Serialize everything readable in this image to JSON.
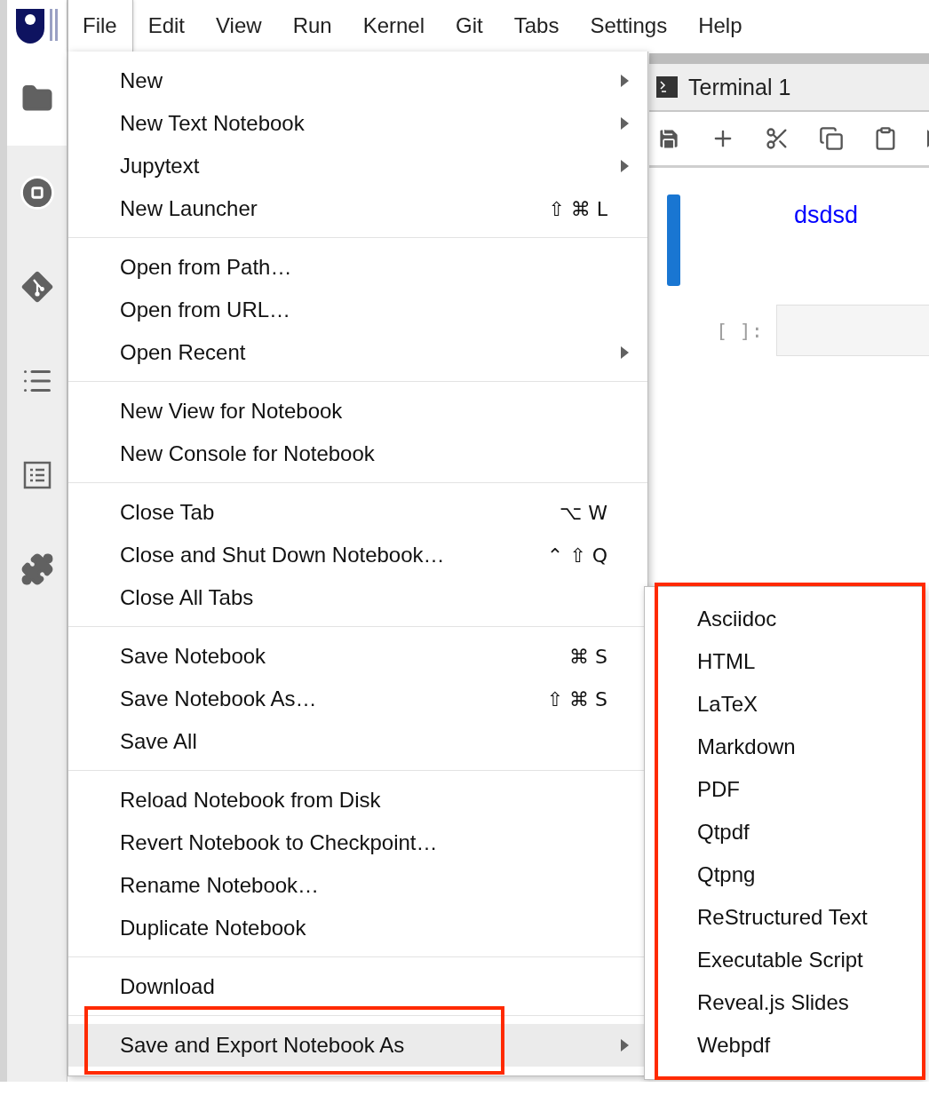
{
  "menubar": [
    {
      "label": "File",
      "selected": true
    },
    {
      "label": "Edit",
      "selected": false
    },
    {
      "label": "View",
      "selected": false
    },
    {
      "label": "Run",
      "selected": false
    },
    {
      "label": "Kernel",
      "selected": false
    },
    {
      "label": "Git",
      "selected": false
    },
    {
      "label": "Tabs",
      "selected": false
    },
    {
      "label": "Settings",
      "selected": false
    },
    {
      "label": "Help",
      "selected": false
    }
  ],
  "sidebar": {
    "items": [
      {
        "kind": "folder",
        "selected": true
      },
      {
        "kind": "running",
        "selected": false
      },
      {
        "kind": "git",
        "selected": false
      },
      {
        "kind": "toc",
        "selected": false
      },
      {
        "kind": "commands",
        "selected": false
      },
      {
        "kind": "extensions",
        "selected": false
      }
    ]
  },
  "file_menu": {
    "groups": [
      [
        {
          "label": "New",
          "submenu": true,
          "selected": false
        },
        {
          "label": "New Text Notebook",
          "submenu": true,
          "selected": false
        },
        {
          "label": "Jupytext",
          "submenu": true,
          "selected": false
        },
        {
          "label": "New Launcher",
          "shortcut": "⇧ ⌘ L",
          "submenu": false,
          "selected": false
        }
      ],
      [
        {
          "label": "Open from Path…",
          "submenu": false,
          "selected": false
        },
        {
          "label": "Open from URL…",
          "submenu": false,
          "selected": false
        },
        {
          "label": "Open Recent",
          "submenu": true,
          "selected": false
        }
      ],
      [
        {
          "label": "New View for Notebook",
          "submenu": false,
          "selected": false
        },
        {
          "label": "New Console for Notebook",
          "submenu": false,
          "selected": false
        }
      ],
      [
        {
          "label": "Close Tab",
          "shortcut": "⌥ W",
          "submenu": false,
          "selected": false
        },
        {
          "label": "Close and Shut Down Notebook…",
          "shortcut": "⌃ ⇧ Q",
          "submenu": false,
          "selected": false
        },
        {
          "label": "Close All Tabs",
          "submenu": false,
          "selected": false
        }
      ],
      [
        {
          "label": "Save Notebook",
          "shortcut": "⌘ S",
          "submenu": false,
          "selected": false
        },
        {
          "label": "Save Notebook As…",
          "shortcut": "⇧ ⌘ S",
          "submenu": false,
          "selected": false
        },
        {
          "label": "Save All",
          "submenu": false,
          "selected": false
        }
      ],
      [
        {
          "label": "Reload Notebook from Disk",
          "submenu": false,
          "selected": false
        },
        {
          "label": "Revert Notebook to Checkpoint…",
          "submenu": false,
          "selected": false
        },
        {
          "label": "Rename Notebook…",
          "submenu": false,
          "selected": false
        },
        {
          "label": "Duplicate Notebook",
          "submenu": false,
          "selected": false
        }
      ],
      [
        {
          "label": "Download",
          "submenu": false,
          "selected": false
        }
      ],
      [
        {
          "label": "Save and Export Notebook As",
          "submenu": true,
          "selected": true,
          "annotated": true
        }
      ]
    ]
  },
  "export_submenu": {
    "annotated": true,
    "items": [
      {
        "label": "Asciidoc"
      },
      {
        "label": "HTML"
      },
      {
        "label": "LaTeX"
      },
      {
        "label": "Markdown"
      },
      {
        "label": "PDF"
      },
      {
        "label": "Qtpdf"
      },
      {
        "label": "Qtpng"
      },
      {
        "label": "ReStructured Text"
      },
      {
        "label": "Executable Script"
      },
      {
        "label": "Reveal.js Slides"
      },
      {
        "label": "Webpdf"
      }
    ]
  },
  "tab": {
    "title": "Terminal 1"
  },
  "cell": {
    "markdown": "dsdsd",
    "prompt": "[ ]:"
  }
}
